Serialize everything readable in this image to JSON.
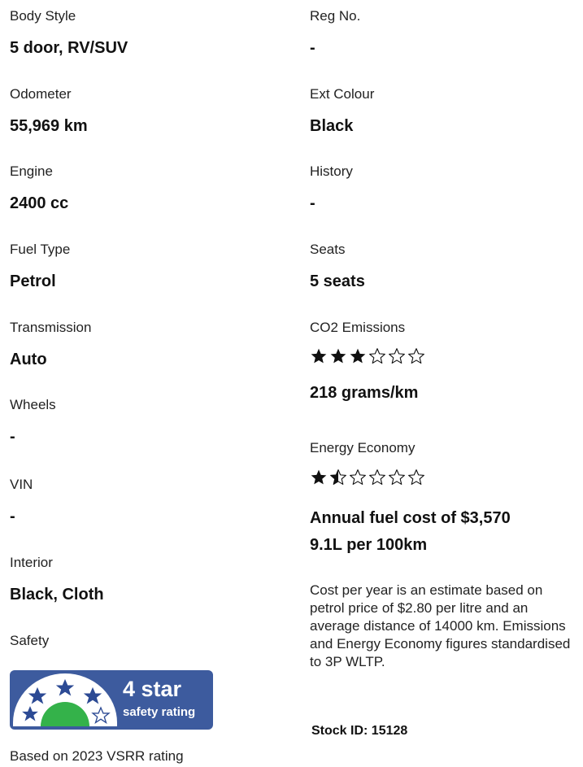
{
  "left_column": [
    {
      "label": "Body Style",
      "value": "5 door, RV/SUV"
    },
    {
      "label": "Odometer",
      "value": "55,969 km"
    },
    {
      "label": "Engine",
      "value": "2400 cc"
    },
    {
      "label": "Fuel Type",
      "value": "Petrol"
    },
    {
      "label": "Transmission",
      "value": "Auto"
    },
    {
      "label": "Wheels",
      "value": "-"
    },
    {
      "label": "VIN",
      "value": "-"
    },
    {
      "label": "Interior",
      "value": "Black, Cloth"
    }
  ],
  "right_column": [
    {
      "label": "Reg No.",
      "value": "-"
    },
    {
      "label": "Ext Colour",
      "value": "Black"
    },
    {
      "label": "History",
      "value": "-"
    },
    {
      "label": "Seats",
      "value": "5 seats"
    }
  ],
  "co2": {
    "label": "CO2 Emissions",
    "rating": 3,
    "max": 6,
    "value": "218 grams/km"
  },
  "energy": {
    "label": "Energy Economy",
    "rating": 1.5,
    "max": 6,
    "annual_cost": "Annual fuel cost of $3,570",
    "consumption": "9.1L per 100km"
  },
  "note": "Cost per year is an estimate based on petrol price of  $2.80 per litre and an average distance of 14000 km. Emissions and Energy Economy figures standardised to 3P WLTP.",
  "stock": "Stock ID: 15128",
  "safety": {
    "label": "Safety",
    "badge_big": "4 star",
    "badge_small": "safety rating",
    "stars": 4,
    "basis": "Based on 2023 VSRR rating",
    "colors": {
      "badge": "#3d5b9e",
      "star": "#2c4a94",
      "green": "#34b24a"
    }
  }
}
